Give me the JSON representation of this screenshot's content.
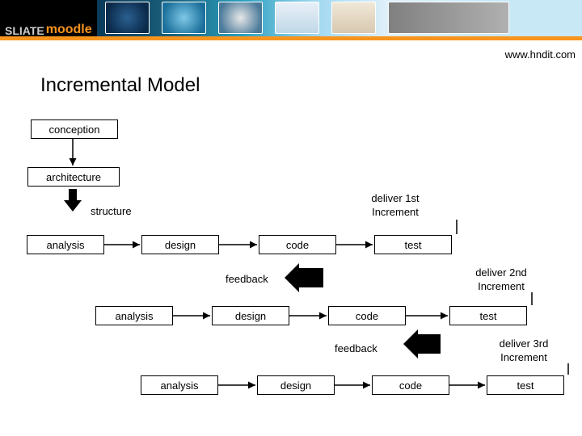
{
  "banner": {
    "logo_left": "SLIATE",
    "logo_right": "moodle"
  },
  "url": "www.hndit.com",
  "title": "Incremental Model",
  "boxes": {
    "conception": "conception",
    "architecture": "architecture",
    "structure": "structure",
    "analysis": "analysis",
    "design": "design",
    "code": "code",
    "test": "test"
  },
  "labels": {
    "deliver1": "deliver 1st Increment",
    "deliver2": "deliver 2nd Increment",
    "deliver3": "deliver 3rd Increment",
    "feedback": "feedback"
  }
}
